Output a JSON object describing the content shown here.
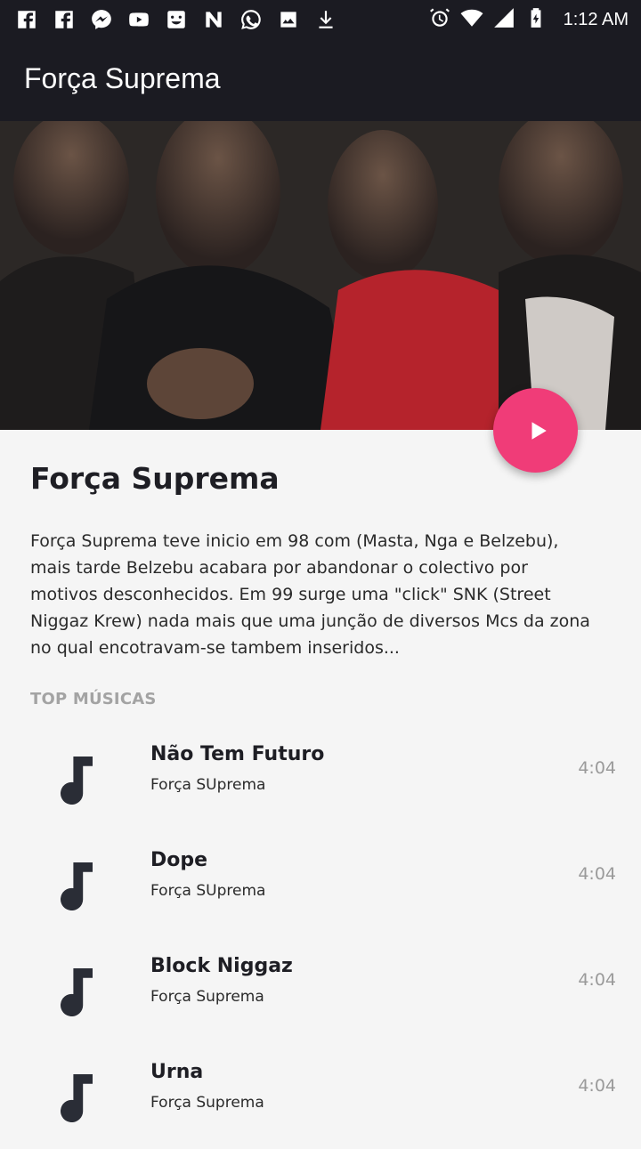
{
  "status_bar": {
    "time": "1:12 AM",
    "left_icons": [
      "facebook-icon",
      "facebook-icon",
      "messenger-icon",
      "youtube-icon",
      "app-icon",
      "n-icon",
      "whatsapp-icon",
      "image-icon",
      "download-icon"
    ],
    "right_icons": [
      "alarm-icon",
      "wifi-icon",
      "signal-icon",
      "battery-charging-icon"
    ]
  },
  "app_bar": {
    "title": "Força Suprema"
  },
  "artist": {
    "name": "Força Suprema",
    "bio": "Força Suprema teve inicio em 98 com (Masta, Nga e Belzebu), mais tarde Belzebu acabara por abandonar o colectivo por motivos desconhecidos. Em 99 surge uma \"click\" SNK (Street Niggaz Krew) nada mais que uma junção de diversos Mcs da zona no qual encotravam-se tambem inseridos..."
  },
  "section": {
    "label": "TOP MÚSICAS"
  },
  "tracks": [
    {
      "title": "Não Tem Futuro",
      "artist": "Força SUprema",
      "duration": "4:04"
    },
    {
      "title": "Dope",
      "artist": "Força SUprema",
      "duration": "4:04"
    },
    {
      "title": "Block Niggaz",
      "artist": "Força Suprema",
      "duration": "4:04"
    },
    {
      "title": "Urna",
      "artist": "Força Suprema",
      "duration": "4:04"
    }
  ],
  "colors": {
    "bar": "#1b1b22",
    "accent": "#f03c78",
    "background": "#f5f5f5"
  }
}
